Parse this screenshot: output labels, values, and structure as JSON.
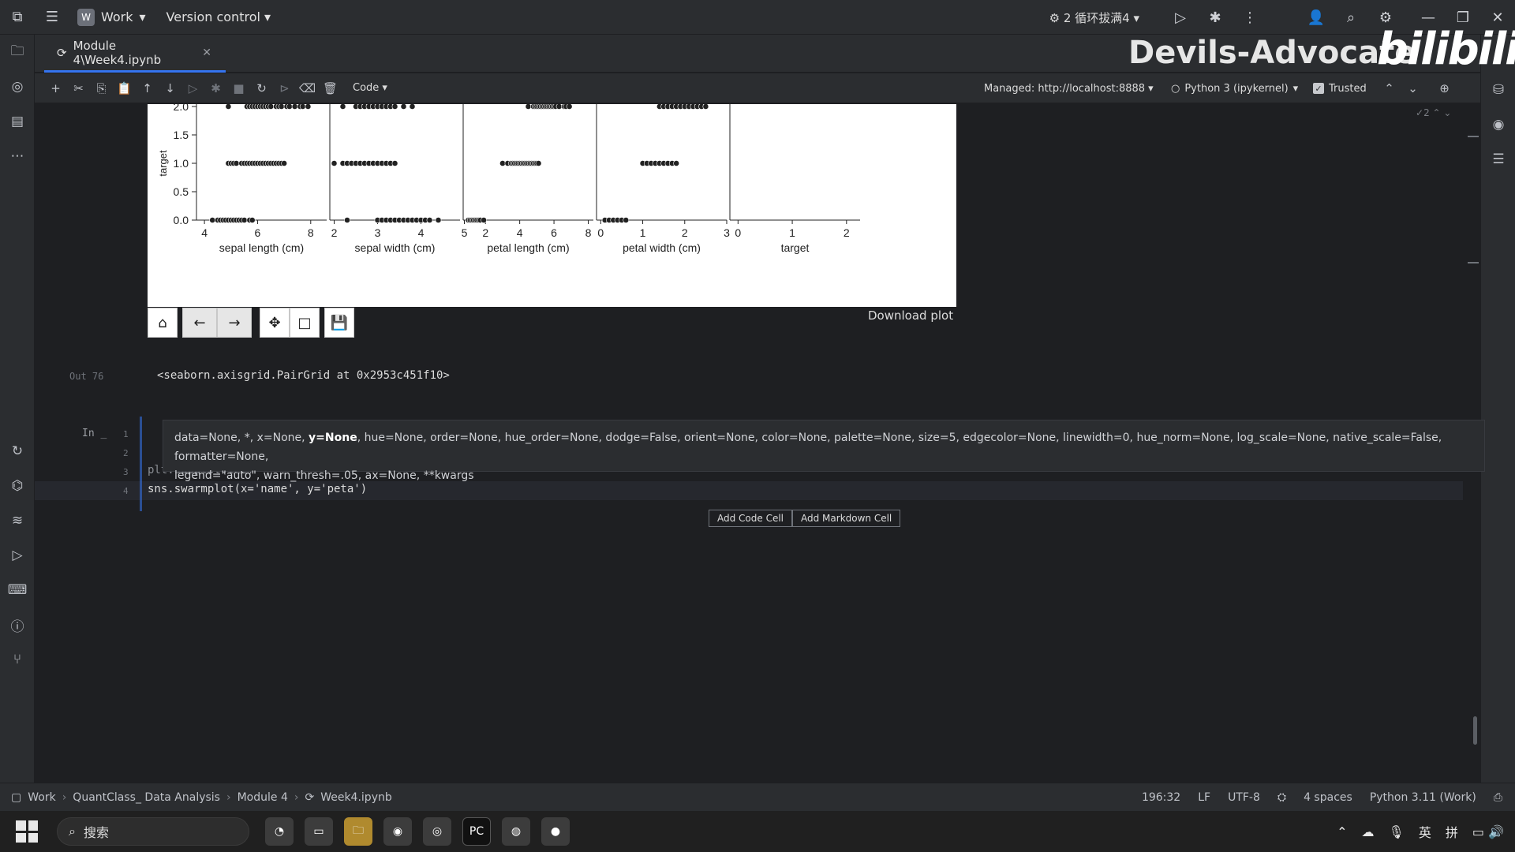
{
  "titlebar": {
    "project": "Work",
    "project_badge": "W",
    "version_control": "Version control",
    "run_config": "2 循环拔满4"
  },
  "tab": {
    "label": "Module 4\\Week4.ipynb"
  },
  "watermark": {
    "channel": "Devils-Advocate",
    "logo": "bilibili"
  },
  "toolbar": {
    "cell_type": "Code",
    "managed": "Managed: http://localhost:8888",
    "kernel": "Python 3 (ipykernel)",
    "trusted": "Trusted",
    "inspection_count": "2"
  },
  "plot": {
    "download": "Download plot"
  },
  "output": {
    "label": "Out 76",
    "text": "<seaborn.axisgrid.PairGrid at 0x2953c451f10>"
  },
  "cell": {
    "in_label": "In _",
    "line_numbers": [
      "1",
      "2",
      "3",
      "4"
    ],
    "line3": "plt.subplot(122)",
    "line4": "sns.swarmplot(x='name', y='peta')"
  },
  "popup": {
    "line1_before": "data=None, *, x=None, ",
    "line1_bold": "y=None",
    "line1_after": ", hue=None, order=None, hue_order=None, dodge=False, orient=None, color=None, palette=None, size=5, edgecolor=None, linewidth=0, hue_norm=None, log_scale=None, native_scale=False, formatter=None,",
    "line2": "legend=\"auto\", warn_thresh=.05, ax=None, **kwargs"
  },
  "add_cell": {
    "code": "Add Code Cell",
    "markdown": "Add Markdown Cell"
  },
  "statusbar": {
    "crumbs": [
      "Work",
      "QuantClass_ Data Analysis",
      "Module 4",
      "Week4.ipynb"
    ],
    "position": "196:32",
    "line_sep": "LF",
    "encoding": "UTF-8",
    "indent": "4 spaces",
    "interpreter": "Python 3.11 (Work)"
  },
  "taskbar": {
    "search": "搜索",
    "ime_lang": "英",
    "ime_mode": "拼"
  },
  "chart_data": {
    "type": "scatter",
    "ylabel": "target",
    "ylim": [
      0,
      2
    ],
    "yticks": [
      "0.0",
      "0.5",
      "1.0",
      "1.5",
      "2.0"
    ],
    "panels": [
      {
        "xlabel": "sepal length (cm)",
        "xticks": [
          "4",
          "6",
          "8"
        ],
        "xlim": [
          3.7,
          8.6
        ],
        "series": [
          {
            "y": 0,
            "x": [
              4.3,
              4.5,
              4.6,
              4.7,
              4.8,
              4.9,
              5.0,
              5.1,
              5.2,
              5.3,
              5.4,
              5.5,
              5.7,
              5.8
            ]
          },
          {
            "y": 1,
            "x": [
              4.9,
              5.0,
              5.1,
              5.2,
              5.4,
              5.5,
              5.6,
              5.7,
              5.8,
              5.9,
              6.0,
              6.1,
              6.2,
              6.3,
              6.4,
              6.5,
              6.6,
              6.7,
              6.8,
              6.9,
              7.0
            ]
          },
          {
            "y": 2,
            "x": [
              4.9,
              5.6,
              5.7,
              5.8,
              5.9,
              6.0,
              6.1,
              6.2,
              6.3,
              6.4,
              6.5,
              6.7,
              6.8,
              6.9,
              7.1,
              7.2,
              7.4,
              7.6,
              7.7,
              7.9
            ]
          }
        ]
      },
      {
        "xlabel": "sepal width (cm)",
        "xticks": [
          "2",
          "3",
          "4",
          "5"
        ],
        "xlim": [
          1.9,
          4.9
        ],
        "series": [
          {
            "y": 0,
            "x": [
              2.3,
              3.0,
              3.1,
              3.2,
              3.3,
              3.4,
              3.5,
              3.6,
              3.7,
              3.8,
              3.9,
              4.0,
              4.1,
              4.2,
              4.4
            ]
          },
          {
            "y": 1,
            "x": [
              2.0,
              2.2,
              2.3,
              2.4,
              2.5,
              2.6,
              2.7,
              2.8,
              2.9,
              3.0,
              3.1,
              3.2,
              3.3,
              3.4
            ]
          },
          {
            "y": 2,
            "x": [
              2.2,
              2.5,
              2.6,
              2.7,
              2.8,
              2.9,
              3.0,
              3.1,
              3.2,
              3.3,
              3.4,
              3.6,
              3.8
            ]
          }
        ]
      },
      {
        "xlabel": "petal length (cm)",
        "xticks": [
          "2",
          "4",
          "6",
          "8"
        ],
        "xlim": [
          0.7,
          8.3
        ],
        "series": [
          {
            "y": 0,
            "x": [
              1.0,
              1.1,
              1.2,
              1.3,
              1.4,
              1.5,
              1.6,
              1.7,
              1.9
            ]
          },
          {
            "y": 1,
            "x": [
              3.0,
              3.3,
              3.5,
              3.6,
              3.7,
              3.8,
              3.9,
              4.0,
              4.1,
              4.2,
              4.3,
              4.4,
              4.5,
              4.6,
              4.7,
              4.8,
              4.9,
              5.0,
              5.1
            ]
          },
          {
            "y": 2,
            "x": [
              4.5,
              4.8,
              4.9,
              5.0,
              5.1,
              5.2,
              5.3,
              5.4,
              5.5,
              5.6,
              5.7,
              5.8,
              5.9,
              6.0,
              6.1,
              6.3,
              6.6,
              6.7,
              6.9
            ]
          }
        ]
      },
      {
        "xlabel": "petal width (cm)",
        "xticks": [
          "0",
          "1",
          "2",
          "3"
        ],
        "xlim": [
          -0.1,
          3.0
        ],
        "series": [
          {
            "y": 0,
            "x": [
              0.1,
              0.2,
              0.3,
              0.4,
              0.5,
              0.6
            ]
          },
          {
            "y": 1,
            "x": [
              1.0,
              1.1,
              1.2,
              1.3,
              1.4,
              1.5,
              1.6,
              1.7,
              1.8
            ]
          },
          {
            "y": 2,
            "x": [
              1.4,
              1.5,
              1.6,
              1.7,
              1.8,
              1.9,
              2.0,
              2.1,
              2.2,
              2.3,
              2.4,
              2.5
            ]
          }
        ]
      },
      {
        "xlabel": "target",
        "xticks": [
          "0",
          "1",
          "2"
        ],
        "xlim": [
          -0.15,
          2.25
        ],
        "series": []
      }
    ]
  }
}
